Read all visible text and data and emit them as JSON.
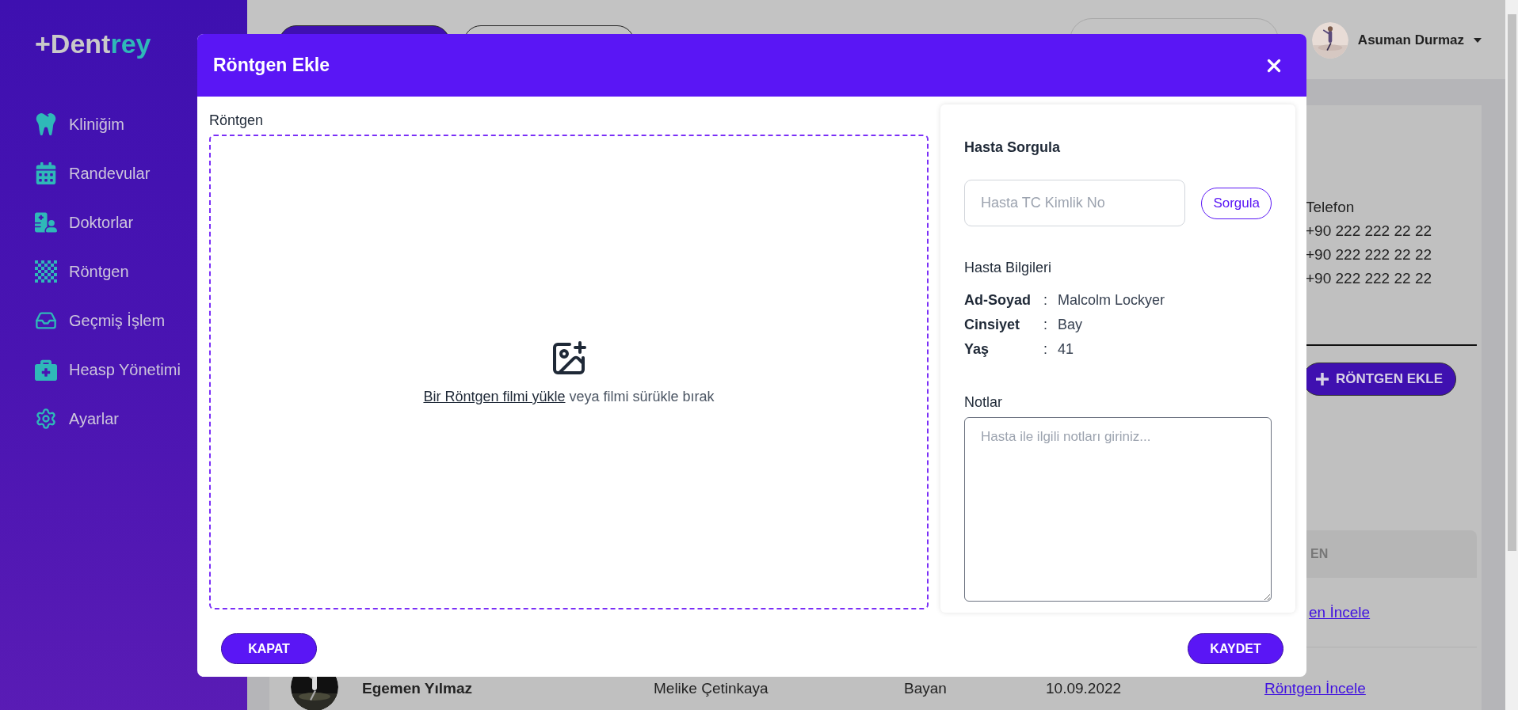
{
  "sidebar": {
    "logo": {
      "prefix": "+Dent",
      "accent": "rey"
    },
    "items": [
      {
        "label": "Kliniğim"
      },
      {
        "label": "Randevular"
      },
      {
        "label": "Doktorlar"
      },
      {
        "label": "Röntgen"
      },
      {
        "label": "Geçmiş İşlem"
      },
      {
        "label": "Heasp Yönetimi"
      },
      {
        "label": "Ayarlar"
      }
    ]
  },
  "topbar": {
    "user": {
      "name": "Asuman Durmaz"
    }
  },
  "background": {
    "contact": {
      "heading": "Telefon",
      "phones": [
        "+90 222 222 22 22",
        "+90 222 222 22 22",
        "+90 222 222 22 22"
      ]
    },
    "add_button": {
      "label": "RÖNTGEN EKLE"
    },
    "table": {
      "column_6_header": "EN",
      "rows": [
        {
          "action": "en İncele"
        },
        {
          "name": "Egemen Yılmaz",
          "doctor": "Melike Çetinkaya",
          "gender": "Bayan",
          "date": "10.09.2022",
          "action": "Röntgen İncele"
        }
      ]
    }
  },
  "modal": {
    "title": "Röntgen Ekle",
    "upload": {
      "label": "Röntgen",
      "link": "Bir Röntgen filmi yükle",
      "hint": "veya filmi sürükle bırak"
    },
    "query": {
      "title": "Hasta Sorgula",
      "placeholder": "Hasta TC Kimlik No",
      "button": "Sorgula"
    },
    "patient": {
      "title": "Hasta Bilgileri",
      "fields": [
        {
          "label": "Ad-Soyad",
          "separator": ":",
          "value": "Malcolm Lockyer"
        },
        {
          "label": "Cinsiyet",
          "separator": ":",
          "value": "Bay"
        },
        {
          "label": "Yaş",
          "separator": ":",
          "value": "41"
        }
      ]
    },
    "notes": {
      "label": "Notlar",
      "placeholder": "Hasta ile ilgili notları giriniz..."
    },
    "footer": {
      "buttons": [
        {
          "label": "KAPAT"
        },
        {
          "label": "KAYDET"
        }
      ]
    }
  }
}
